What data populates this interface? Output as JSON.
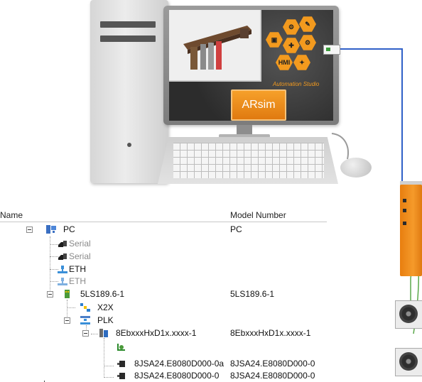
{
  "illustration": {
    "app_badge": "ARsim",
    "screen_hex_icons": [
      "gear-icon",
      "wrench-icon",
      "plc-icon",
      "chart-icon",
      "network-icon"
    ],
    "hmi_text": "HMI",
    "studio_text": "Automation Studio"
  },
  "tree": {
    "columns": {
      "name": "Name",
      "model": "Model Number"
    },
    "rows": {
      "pc": {
        "label": "PC",
        "model": "PC"
      },
      "serial1": {
        "label": "Serial"
      },
      "serial2": {
        "label": "Serial"
      },
      "eth1": {
        "label": "ETH"
      },
      "eth2": {
        "label": "ETH"
      },
      "plc": {
        "label": "5LS189.6-1",
        "model": "5LS189.6-1"
      },
      "x2x": {
        "label": "X2X"
      },
      "plk": {
        "label": "PLK"
      },
      "drive": {
        "label": "8EbxxxHxD1x.xxxx-1",
        "model": "8EbxxxHxD1x.xxxx-1"
      },
      "motor1": {
        "label": "8JSA24.E8080D000-0a",
        "model": "8JSA24.E8080D000-0"
      },
      "motor2": {
        "label": "8JSA24.E8080D000-0",
        "model": "8JSA24.E8080D000-0"
      }
    }
  },
  "colors": {
    "accent_orange": "#f39a1e",
    "cable_blue": "#3060c8"
  }
}
